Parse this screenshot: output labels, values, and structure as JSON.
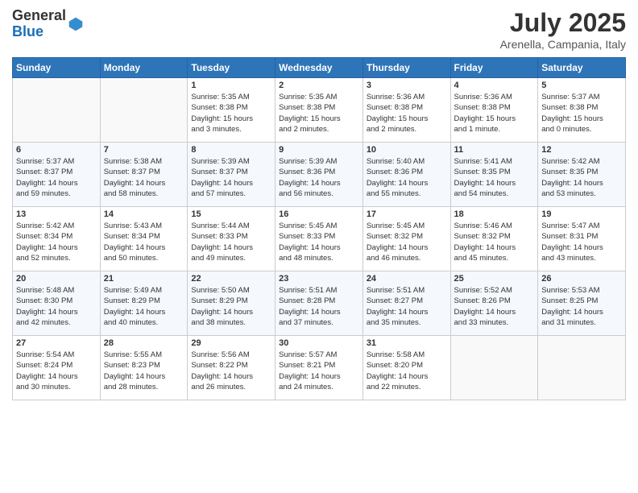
{
  "logo": {
    "general": "General",
    "blue": "Blue"
  },
  "title": "July 2025",
  "location": "Arenella, Campania, Italy",
  "weekdays": [
    "Sunday",
    "Monday",
    "Tuesday",
    "Wednesday",
    "Thursday",
    "Friday",
    "Saturday"
  ],
  "weeks": [
    [
      {
        "day": "",
        "info": ""
      },
      {
        "day": "",
        "info": ""
      },
      {
        "day": "1",
        "info": "Sunrise: 5:35 AM\nSunset: 8:38 PM\nDaylight: 15 hours\nand 3 minutes."
      },
      {
        "day": "2",
        "info": "Sunrise: 5:35 AM\nSunset: 8:38 PM\nDaylight: 15 hours\nand 2 minutes."
      },
      {
        "day": "3",
        "info": "Sunrise: 5:36 AM\nSunset: 8:38 PM\nDaylight: 15 hours\nand 2 minutes."
      },
      {
        "day": "4",
        "info": "Sunrise: 5:36 AM\nSunset: 8:38 PM\nDaylight: 15 hours\nand 1 minute."
      },
      {
        "day": "5",
        "info": "Sunrise: 5:37 AM\nSunset: 8:38 PM\nDaylight: 15 hours\nand 0 minutes."
      }
    ],
    [
      {
        "day": "6",
        "info": "Sunrise: 5:37 AM\nSunset: 8:37 PM\nDaylight: 14 hours\nand 59 minutes."
      },
      {
        "day": "7",
        "info": "Sunrise: 5:38 AM\nSunset: 8:37 PM\nDaylight: 14 hours\nand 58 minutes."
      },
      {
        "day": "8",
        "info": "Sunrise: 5:39 AM\nSunset: 8:37 PM\nDaylight: 14 hours\nand 57 minutes."
      },
      {
        "day": "9",
        "info": "Sunrise: 5:39 AM\nSunset: 8:36 PM\nDaylight: 14 hours\nand 56 minutes."
      },
      {
        "day": "10",
        "info": "Sunrise: 5:40 AM\nSunset: 8:36 PM\nDaylight: 14 hours\nand 55 minutes."
      },
      {
        "day": "11",
        "info": "Sunrise: 5:41 AM\nSunset: 8:35 PM\nDaylight: 14 hours\nand 54 minutes."
      },
      {
        "day": "12",
        "info": "Sunrise: 5:42 AM\nSunset: 8:35 PM\nDaylight: 14 hours\nand 53 minutes."
      }
    ],
    [
      {
        "day": "13",
        "info": "Sunrise: 5:42 AM\nSunset: 8:34 PM\nDaylight: 14 hours\nand 52 minutes."
      },
      {
        "day": "14",
        "info": "Sunrise: 5:43 AM\nSunset: 8:34 PM\nDaylight: 14 hours\nand 50 minutes."
      },
      {
        "day": "15",
        "info": "Sunrise: 5:44 AM\nSunset: 8:33 PM\nDaylight: 14 hours\nand 49 minutes."
      },
      {
        "day": "16",
        "info": "Sunrise: 5:45 AM\nSunset: 8:33 PM\nDaylight: 14 hours\nand 48 minutes."
      },
      {
        "day": "17",
        "info": "Sunrise: 5:45 AM\nSunset: 8:32 PM\nDaylight: 14 hours\nand 46 minutes."
      },
      {
        "day": "18",
        "info": "Sunrise: 5:46 AM\nSunset: 8:32 PM\nDaylight: 14 hours\nand 45 minutes."
      },
      {
        "day": "19",
        "info": "Sunrise: 5:47 AM\nSunset: 8:31 PM\nDaylight: 14 hours\nand 43 minutes."
      }
    ],
    [
      {
        "day": "20",
        "info": "Sunrise: 5:48 AM\nSunset: 8:30 PM\nDaylight: 14 hours\nand 42 minutes."
      },
      {
        "day": "21",
        "info": "Sunrise: 5:49 AM\nSunset: 8:29 PM\nDaylight: 14 hours\nand 40 minutes."
      },
      {
        "day": "22",
        "info": "Sunrise: 5:50 AM\nSunset: 8:29 PM\nDaylight: 14 hours\nand 38 minutes."
      },
      {
        "day": "23",
        "info": "Sunrise: 5:51 AM\nSunset: 8:28 PM\nDaylight: 14 hours\nand 37 minutes."
      },
      {
        "day": "24",
        "info": "Sunrise: 5:51 AM\nSunset: 8:27 PM\nDaylight: 14 hours\nand 35 minutes."
      },
      {
        "day": "25",
        "info": "Sunrise: 5:52 AM\nSunset: 8:26 PM\nDaylight: 14 hours\nand 33 minutes."
      },
      {
        "day": "26",
        "info": "Sunrise: 5:53 AM\nSunset: 8:25 PM\nDaylight: 14 hours\nand 31 minutes."
      }
    ],
    [
      {
        "day": "27",
        "info": "Sunrise: 5:54 AM\nSunset: 8:24 PM\nDaylight: 14 hours\nand 30 minutes."
      },
      {
        "day": "28",
        "info": "Sunrise: 5:55 AM\nSunset: 8:23 PM\nDaylight: 14 hours\nand 28 minutes."
      },
      {
        "day": "29",
        "info": "Sunrise: 5:56 AM\nSunset: 8:22 PM\nDaylight: 14 hours\nand 26 minutes."
      },
      {
        "day": "30",
        "info": "Sunrise: 5:57 AM\nSunset: 8:21 PM\nDaylight: 14 hours\nand 24 minutes."
      },
      {
        "day": "31",
        "info": "Sunrise: 5:58 AM\nSunset: 8:20 PM\nDaylight: 14 hours\nand 22 minutes."
      },
      {
        "day": "",
        "info": ""
      },
      {
        "day": "",
        "info": ""
      }
    ]
  ]
}
